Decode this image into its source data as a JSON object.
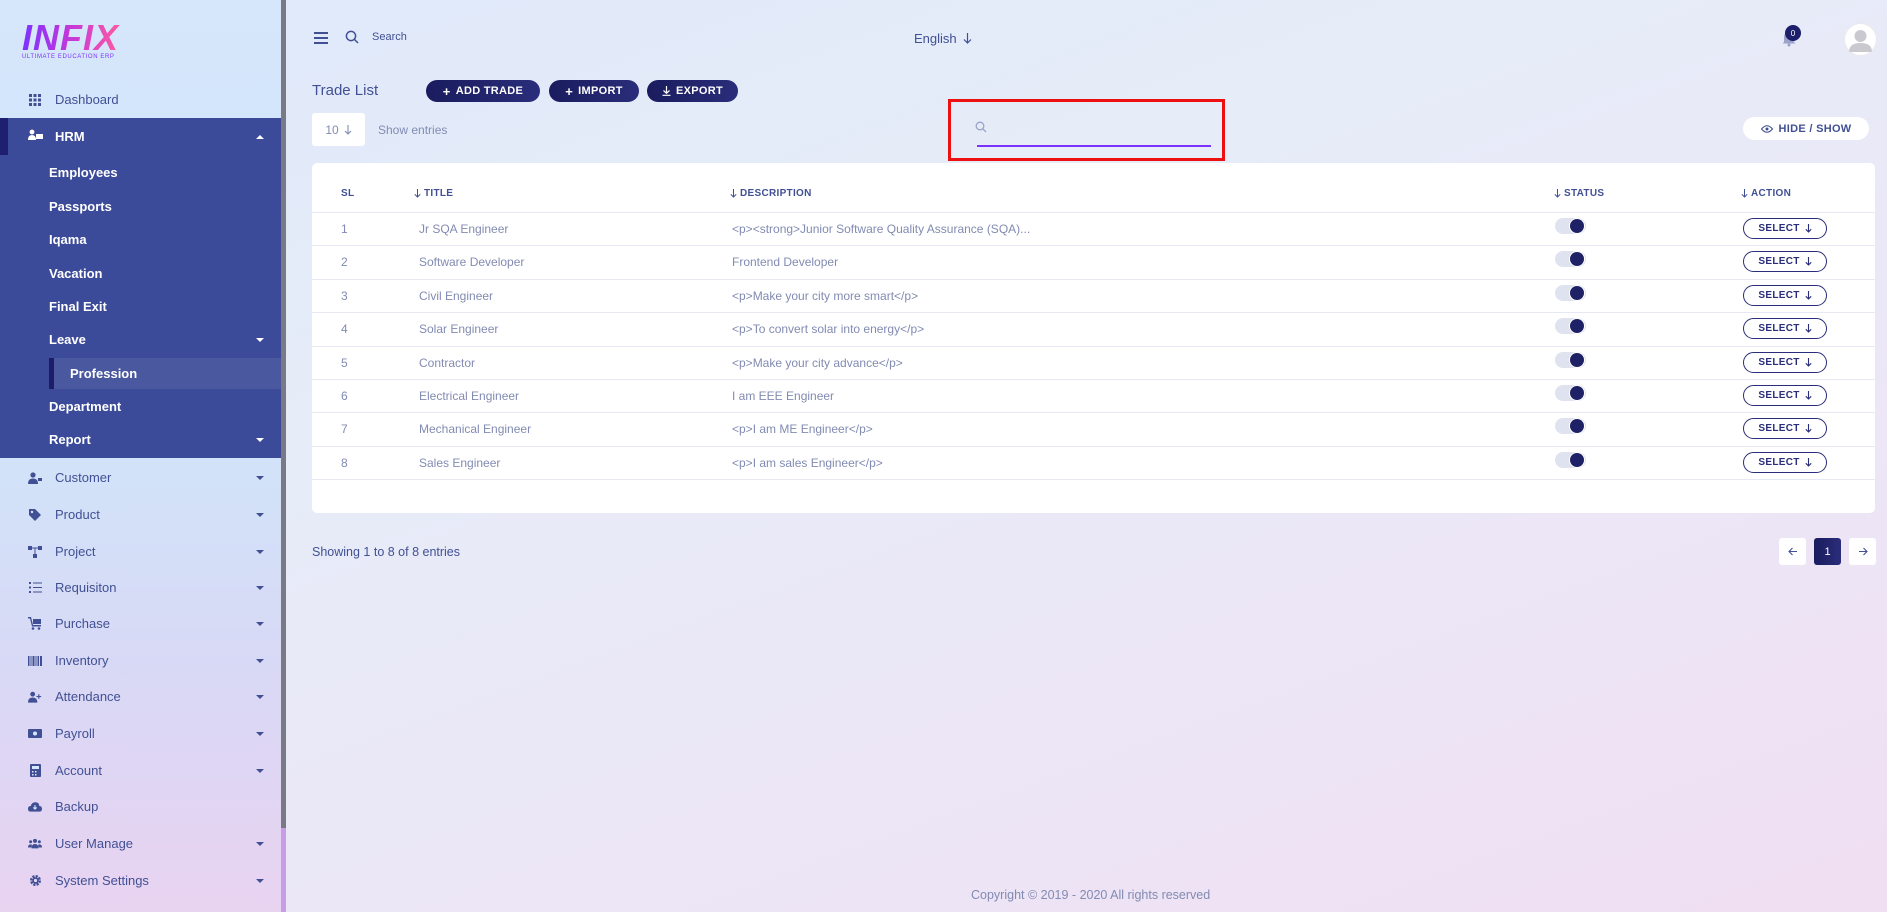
{
  "logo": {
    "text": "INFIX",
    "subtitle": "ULTIMATE EDUCATION ERP"
  },
  "sidebar": {
    "dashboard": "Dashboard",
    "hrm": "HRM",
    "hrm_items": [
      "Employees",
      "Passports",
      "Iqama",
      "Vacation",
      "Final Exit",
      "Leave",
      "Profession",
      "Department",
      "Report"
    ],
    "items": [
      "Customer",
      "Product",
      "Project",
      "Requisiton",
      "Purchase",
      "Inventory",
      "Attendance",
      "Payroll",
      "Account",
      "Backup",
      "User Manage",
      "System Settings"
    ]
  },
  "header": {
    "search_placeholder": "Search",
    "language": "English",
    "notification_count": "0"
  },
  "page": {
    "title": "Trade List",
    "add_button": "ADD TRADE",
    "import_button": "IMPORT",
    "export_button": "EXPORT",
    "entries_value": "10",
    "show_entries": "Show entries",
    "hide_show": "HIDE / SHOW"
  },
  "table": {
    "headers": [
      "SL",
      "TITLE",
      "DESCRIPTION",
      "STATUS",
      "ACTION"
    ],
    "select_label": "SELECT",
    "rows": [
      {
        "sl": "1",
        "title": "Jr SQA Engineer",
        "description": "<p><strong>Junior Software Quality Assurance (SQA)...",
        "status": true
      },
      {
        "sl": "2",
        "title": "Software Developer",
        "description": "Frontend Developer",
        "status": true
      },
      {
        "sl": "3",
        "title": "Civil Engineer",
        "description": "<p>Make your city more smart</p>",
        "status": true
      },
      {
        "sl": "4",
        "title": "Solar Engineer",
        "description": "<p>To convert solar into energy</p>",
        "status": true
      },
      {
        "sl": "5",
        "title": "Contractor",
        "description": "<p>Make your city advance</p>",
        "status": true
      },
      {
        "sl": "6",
        "title": "Electrical Engineer",
        "description": "I am EEE Engineer",
        "status": true
      },
      {
        "sl": "7",
        "title": "Mechanical Engineer",
        "description": "<p>I am ME Engineer</p>",
        "status": true
      },
      {
        "sl": "8",
        "title": "Sales Engineer",
        "description": "<p>I am sales Engineer</p>",
        "status": true
      }
    ]
  },
  "footer": {
    "showing": "Showing 1 to 8 of 8 entries",
    "current_page": "1",
    "copyright": "Copyright © 2019 - 2020 All rights reserved"
  },
  "colors": {
    "primary": "#415094",
    "dark": "#1e1f6e",
    "accent": "#7c32ff",
    "highlight": "#ec1010"
  }
}
